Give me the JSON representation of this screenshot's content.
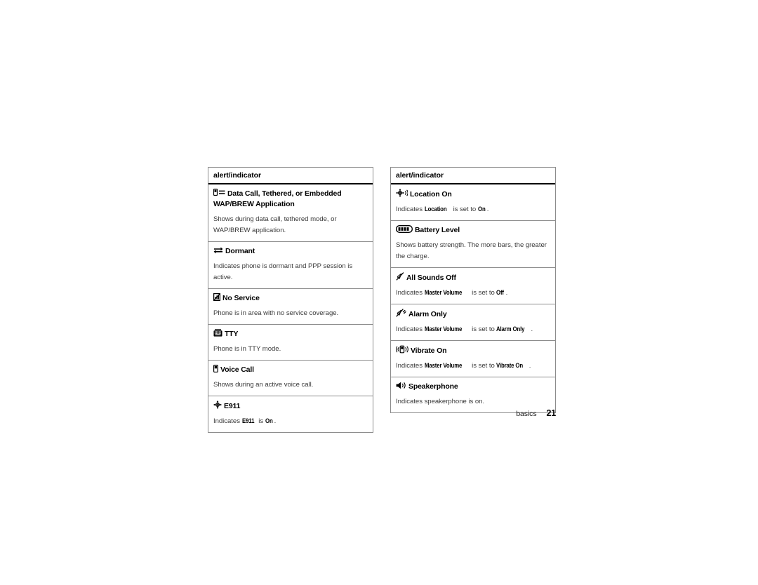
{
  "page": {
    "footer_section": "basics",
    "footer_page_number": "21",
    "text_color": "#000000",
    "border_color": "#8c8c8c",
    "background": "#ffffff"
  },
  "columns": [
    {
      "header": "alert/indicator",
      "rows": [
        {
          "icon": "data-call-icon",
          "term": "Data Call, Tethered, or Embedded WAP/BREW Application",
          "desc_parts": [
            {
              "text": "Shows during data call, tethered mode, or WAP/BREW application.",
              "emphasis": false
            }
          ]
        },
        {
          "icon": "dormant-icon",
          "term": "Dormant",
          "desc_parts": [
            {
              "text": "Indicates phone is dormant and PPP session is active.",
              "emphasis": false
            }
          ]
        },
        {
          "icon": "no-service-icon",
          "term": "No Service",
          "desc_parts": [
            {
              "text": "Phone is in area with no service coverage.",
              "emphasis": false
            }
          ]
        },
        {
          "icon": "tty-icon",
          "term": "TTY",
          "desc_parts": [
            {
              "text": "Phone is in TTY mode.",
              "emphasis": false
            }
          ]
        },
        {
          "icon": "voice-call-icon",
          "term": "Voice Call",
          "desc_parts": [
            {
              "text": "Shows during an active voice call.",
              "emphasis": false
            }
          ]
        },
        {
          "icon": "e911-icon",
          "term": "E911",
          "desc_parts": [
            {
              "text": "Indicates ",
              "emphasis": false
            },
            {
              "text": "E911",
              "emphasis": true
            },
            {
              "text": " is ",
              "emphasis": false
            },
            {
              "text": "On",
              "emphasis": true
            },
            {
              "text": ".",
              "emphasis": false
            }
          ]
        }
      ]
    },
    {
      "header": "alert/indicator",
      "rows": [
        {
          "icon": "location-on-icon",
          "term": "Location On",
          "desc_parts": [
            {
              "text": "Indicates ",
              "emphasis": false
            },
            {
              "text": "Location",
              "emphasis": true
            },
            {
              "text": " is set to ",
              "emphasis": false
            },
            {
              "text": "On",
              "emphasis": true
            },
            {
              "text": ".",
              "emphasis": false
            }
          ]
        },
        {
          "icon": "battery-level-icon",
          "term": "Battery Level",
          "desc_parts": [
            {
              "text": "Shows battery strength. The more bars, the greater the charge.",
              "emphasis": false
            }
          ]
        },
        {
          "icon": "all-sounds-off-icon",
          "term": "All Sounds Off",
          "desc_parts": [
            {
              "text": "Indicates ",
              "emphasis": false
            },
            {
              "text": "Master Volume",
              "emphasis": true
            },
            {
              "text": " is set to ",
              "emphasis": false
            },
            {
              "text": "Off",
              "emphasis": true
            },
            {
              "text": ".",
              "emphasis": false
            }
          ]
        },
        {
          "icon": "alarm-only-icon",
          "term": "Alarm Only",
          "desc_parts": [
            {
              "text": "Indicates ",
              "emphasis": false
            },
            {
              "text": "Master Volume",
              "emphasis": true
            },
            {
              "text": " is set to ",
              "emphasis": false
            },
            {
              "text": "Alarm Only",
              "emphasis": true
            },
            {
              "text": ".",
              "emphasis": false
            }
          ]
        },
        {
          "icon": "vibrate-on-icon",
          "term": "Vibrate On",
          "desc_parts": [
            {
              "text": "Indicates ",
              "emphasis": false
            },
            {
              "text": "Master Volume",
              "emphasis": true
            },
            {
              "text": " is set to ",
              "emphasis": false
            },
            {
              "text": "Vibrate On",
              "emphasis": true
            },
            {
              "text": ".",
              "emphasis": false
            }
          ]
        },
        {
          "icon": "speakerphone-icon",
          "term": "Speakerphone",
          "desc_parts": [
            {
              "text": "Indicates speakerphone is on.",
              "emphasis": false
            }
          ]
        }
      ]
    }
  ]
}
